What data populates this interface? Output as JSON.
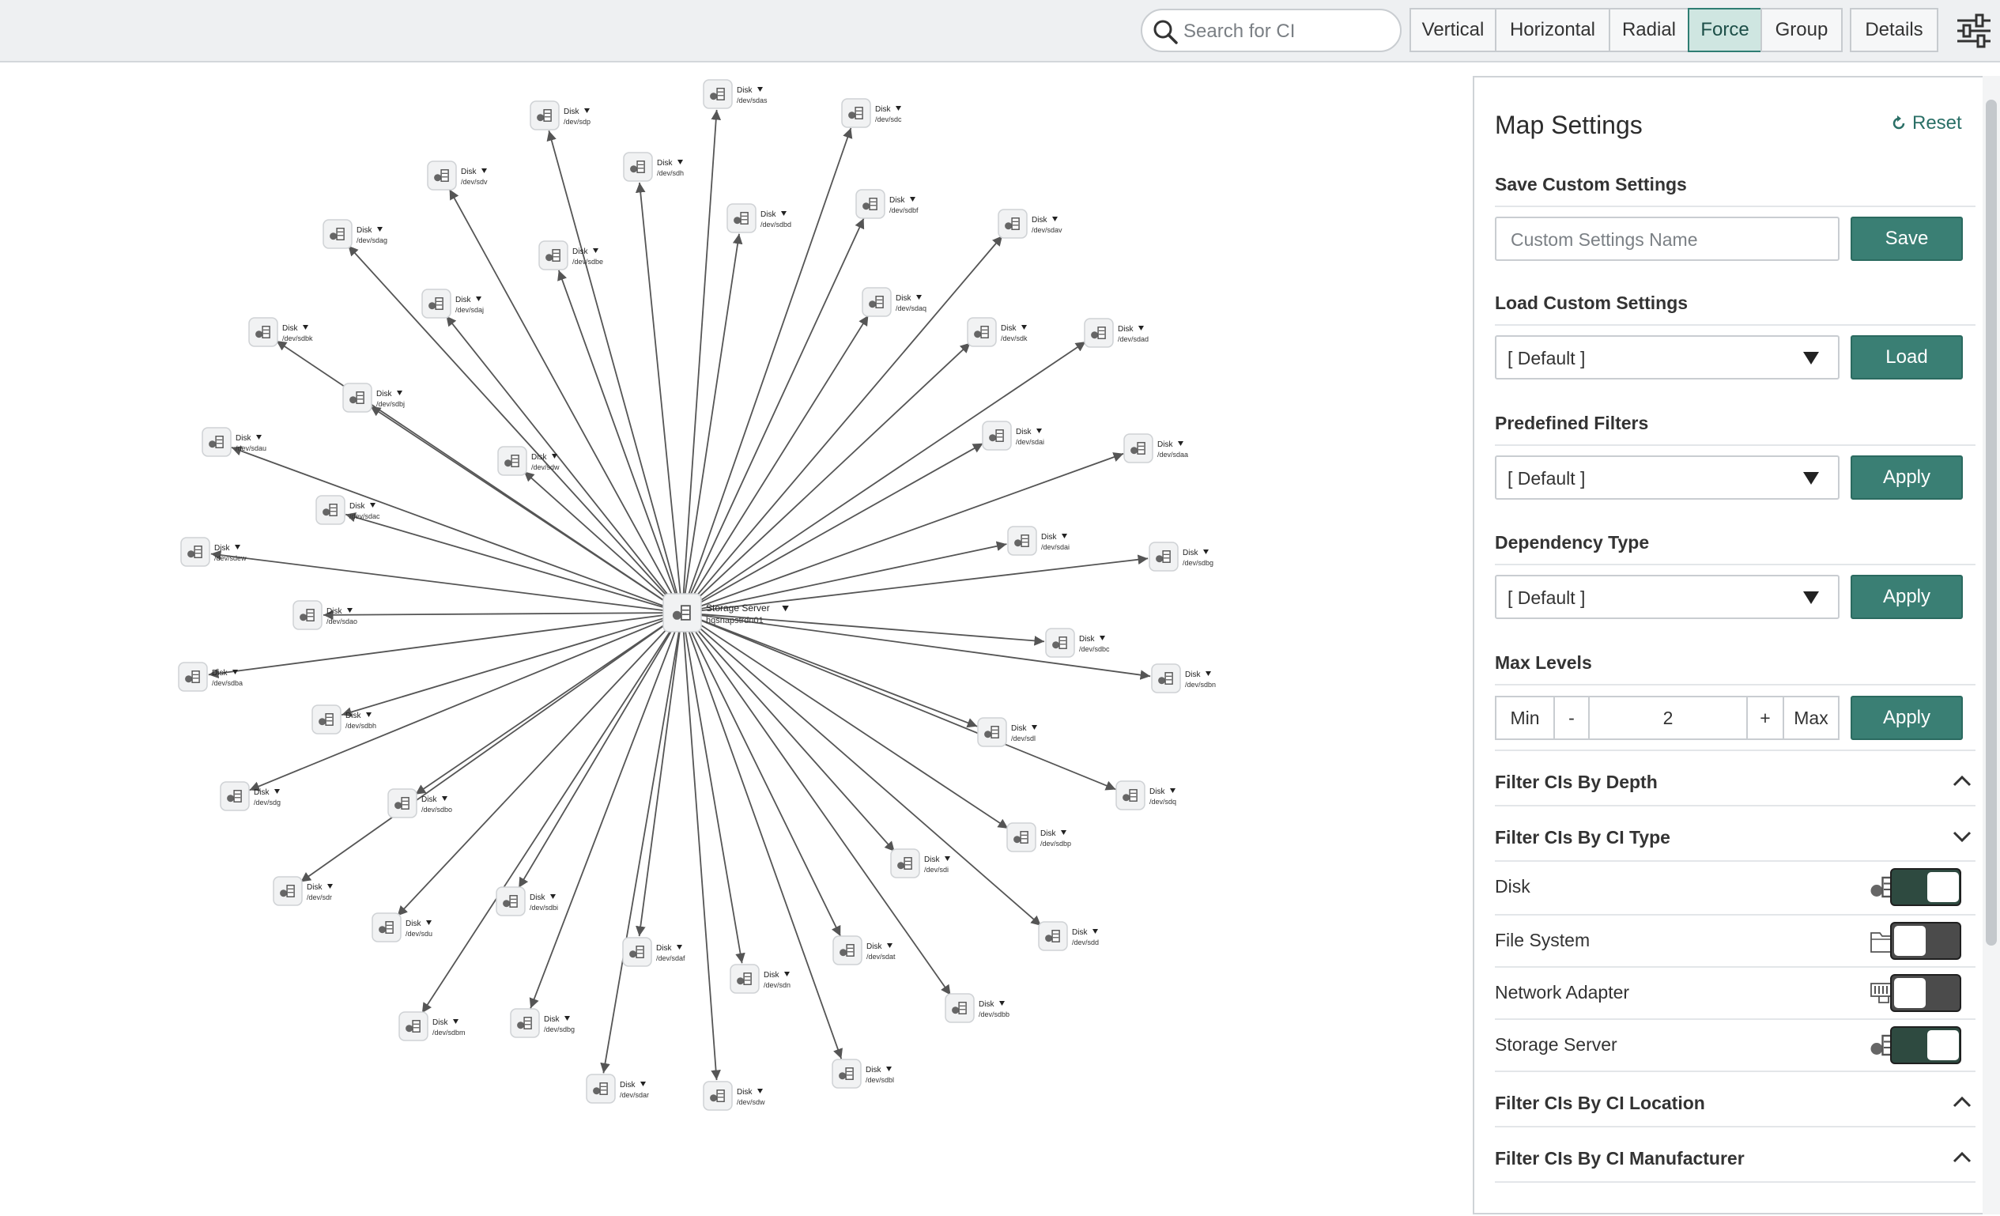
{
  "toolbar": {
    "search_placeholder": "Search for CI",
    "buttons": [
      {
        "key": "vertical",
        "label": "Vertical"
      },
      {
        "key": "horizontal",
        "label": "Horizontal"
      },
      {
        "key": "radial",
        "label": "Radial"
      },
      {
        "key": "force",
        "label": "Force",
        "active": true
      },
      {
        "key": "group",
        "label": "Group"
      },
      {
        "key": "details",
        "label": "Details"
      }
    ]
  },
  "graph": {
    "center": {
      "type": "Storage Server",
      "name": "hqsnapstrdn01",
      "icon": "storage-server-icon"
    },
    "nodes": [
      {
        "type": "Disk",
        "name": "/dev/sdas"
      },
      {
        "type": "Disk",
        "name": "/dev/sdp"
      },
      {
        "type": "Disk",
        "name": "/dev/sdc"
      },
      {
        "type": "Disk",
        "name": "/dev/sdv"
      },
      {
        "type": "Disk",
        "name": "/dev/sdh"
      },
      {
        "type": "Disk",
        "name": "/dev/sdbf"
      },
      {
        "type": "Disk",
        "name": "/dev/sdbd"
      },
      {
        "type": "Disk",
        "name": "/dev/sdag"
      },
      {
        "type": "Disk",
        "name": "/dev/sdbe"
      },
      {
        "type": "Disk",
        "name": "/dev/sdav"
      },
      {
        "type": "Disk",
        "name": "/dev/sdaj"
      },
      {
        "type": "Disk",
        "name": "/dev/sdaq"
      },
      {
        "type": "Disk",
        "name": "/dev/sdbk"
      },
      {
        "type": "Disk",
        "name": "/dev/sdk"
      },
      {
        "type": "Disk",
        "name": "/dev/sdad"
      },
      {
        "type": "Disk",
        "name": "/dev/sdbj"
      },
      {
        "type": "Disk",
        "name": "/dev/sdau"
      },
      {
        "type": "Disk",
        "name": "/dev/sdai"
      },
      {
        "type": "Disk",
        "name": "/dev/sdaa"
      },
      {
        "type": "Disk",
        "name": "/dev/sdw"
      },
      {
        "type": "Disk",
        "name": "/dev/sdac"
      },
      {
        "type": "Disk",
        "name": "/dev/sdai"
      },
      {
        "type": "Disk",
        "name": "/dev/sdbg"
      },
      {
        "type": "Disk",
        "name": "/dev/sdew"
      },
      {
        "type": "Disk",
        "name": "/dev/sdao"
      },
      {
        "type": "Disk",
        "name": "/dev/sdbc"
      },
      {
        "type": "Disk",
        "name": "/dev/sdba"
      },
      {
        "type": "Disk",
        "name": "/dev/sdbn"
      },
      {
        "type": "Disk",
        "name": "/dev/sdbh"
      },
      {
        "type": "Disk",
        "name": "/dev/sdl"
      },
      {
        "type": "Disk",
        "name": "/dev/sdg"
      },
      {
        "type": "Disk",
        "name": "/dev/sdbo"
      },
      {
        "type": "Disk",
        "name": "/dev/sdq"
      },
      {
        "type": "Disk",
        "name": "/dev/sdbp"
      },
      {
        "type": "Disk",
        "name": "/dev/sdr"
      },
      {
        "type": "Disk",
        "name": "/dev/sdi"
      },
      {
        "type": "Disk",
        "name": "/dev/sdu"
      },
      {
        "type": "Disk",
        "name": "/dev/sdbi"
      },
      {
        "type": "Disk",
        "name": "/dev/sdd"
      },
      {
        "type": "Disk",
        "name": "/dev/sdaf"
      },
      {
        "type": "Disk",
        "name": "/dev/sdat"
      },
      {
        "type": "Disk",
        "name": "/dev/sdn"
      },
      {
        "type": "Disk",
        "name": "/dev/sdbb"
      },
      {
        "type": "Disk",
        "name": "/dev/sdbm"
      },
      {
        "type": "Disk",
        "name": "/dev/sdbg"
      },
      {
        "type": "Disk",
        "name": "/dev/sdbl"
      },
      {
        "type": "Disk",
        "name": "/dev/sdar"
      },
      {
        "type": "Disk",
        "name": "/dev/sdw"
      }
    ]
  },
  "panel": {
    "title": "Map Settings",
    "reset_label": "Reset",
    "save_section": {
      "label": "Save Custom Settings",
      "placeholder": "Custom Settings Name",
      "button": "Save"
    },
    "load_section": {
      "label": "Load Custom Settings",
      "value": "[ Default ]",
      "button": "Load"
    },
    "filters_section": {
      "label": "Predefined Filters",
      "value": "[ Default ]",
      "button": "Apply"
    },
    "dependency_section": {
      "label": "Dependency Type",
      "value": "[ Default ]",
      "button": "Apply"
    },
    "levels_section": {
      "label": "Max Levels",
      "min": "Min",
      "minus": "-",
      "value": "2",
      "plus": "+",
      "max": "Max",
      "button": "Apply"
    },
    "depth_filter": {
      "label": "Filter CIs By Depth"
    },
    "type_filter": {
      "label": "Filter CIs By CI Type",
      "items": [
        {
          "label": "Disk",
          "icon": "disk-icon",
          "on": true
        },
        {
          "label": "File System",
          "icon": "folder-icon",
          "on": false
        },
        {
          "label": "Network Adapter",
          "icon": "network-adapter-icon",
          "on": false
        },
        {
          "label": "Storage Server",
          "icon": "storage-server-icon",
          "on": true
        }
      ]
    },
    "location_filter": {
      "label": "Filter CIs By CI Location"
    },
    "manufacturer_filter": {
      "label": "Filter CIs By CI Manufacturer"
    }
  }
}
